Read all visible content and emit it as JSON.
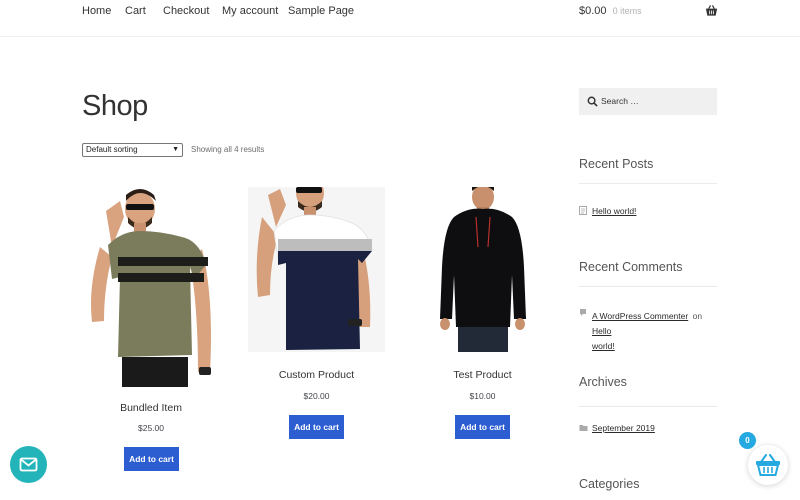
{
  "nav": {
    "items": [
      "Home",
      "Cart",
      "Checkout",
      "My account",
      "Sample Page"
    ]
  },
  "header_cart": {
    "total": "$0.00",
    "count": "0 items",
    "icon": "basket-icon"
  },
  "page": {
    "title": "Shop"
  },
  "toolbar": {
    "sort_value": "Default sorting",
    "result_count": "Showing all 4 results"
  },
  "products": [
    {
      "name": "Bundled Item",
      "price": "$25.00",
      "button": "Add to cart",
      "shirt": "olive-striped-tshirt"
    },
    {
      "name": "Custom Product",
      "price": "$20.00",
      "button": "Add to cart",
      "shirt": "navy-white-colorblock-tshirt"
    },
    {
      "name": "Test Product",
      "price": "$10.00",
      "button": "Add to cart",
      "shirt": "black-hoodie"
    }
  ],
  "sidebar": {
    "search_placeholder": "Search …",
    "recent_posts": {
      "title": "Recent Posts",
      "items": [
        "Hello world!"
      ]
    },
    "recent_comments": {
      "title": "Recent Comments",
      "author": "A WordPress Commenter",
      "on": "on",
      "post_a": "Hello",
      "post_b": "world!"
    },
    "archives": {
      "title": "Archives",
      "items": [
        "September 2019"
      ]
    },
    "categories": {
      "title": "Categories"
    }
  },
  "floating": {
    "cart_badge": "0",
    "chat_icon": "mail-icon",
    "cart_icon": "basket-icon"
  },
  "colors": {
    "accent_button": "#2c5dd1",
    "chat": "#23b4ba",
    "badge": "#24a9e0"
  }
}
